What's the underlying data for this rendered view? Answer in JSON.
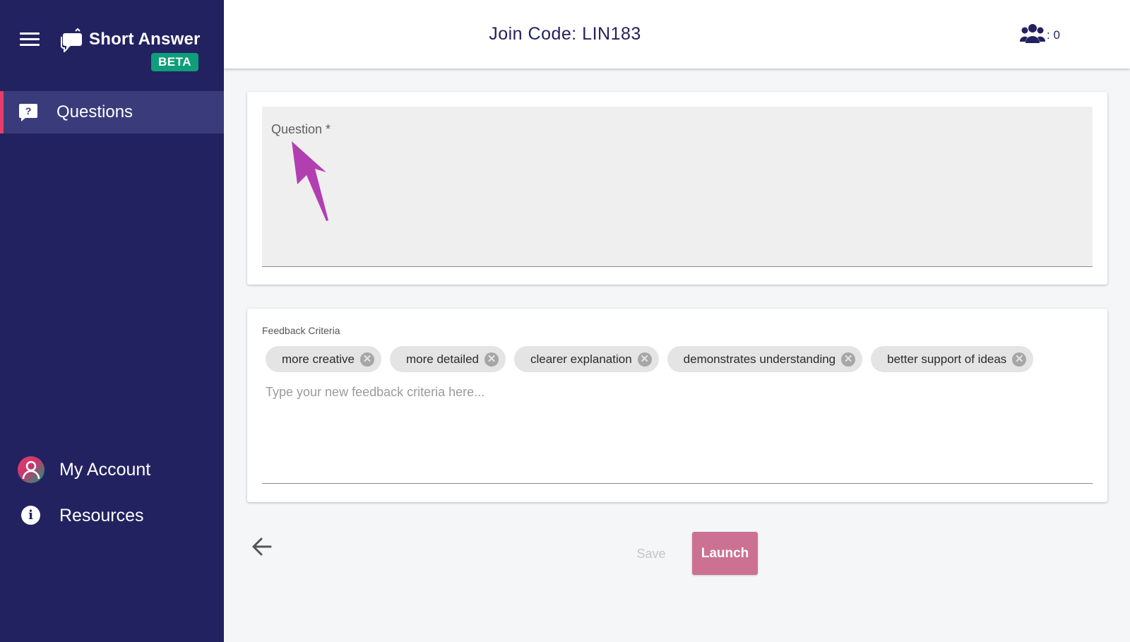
{
  "sidebar": {
    "app_title": "Short Answer",
    "beta_badge": "BETA",
    "nav": {
      "questions": "Questions",
      "my_account": "My Account",
      "resources": "Resources"
    }
  },
  "header": {
    "join_code": "Join Code: LIN183",
    "users_count": ": 0"
  },
  "question": {
    "label": "Question *",
    "value": ""
  },
  "feedback": {
    "label": "Feedback Criteria",
    "chips": [
      "more creative",
      "more detailed",
      "clearer explanation",
      "demonstrates understanding",
      "better support of ideas"
    ],
    "chip_remove_symbol": "✕",
    "input_placeholder": "Type your new feedback criteria here..."
  },
  "actions": {
    "save_label": "Save",
    "launch_label": "Launch"
  },
  "icons": {
    "menu": "hamburger-menu-icon",
    "logo": "speech-bubbles-icon",
    "questions": "question-bubble-icon",
    "users": "users-group-icon",
    "account": "account-avatar-icon",
    "resources": "info-icon",
    "back": "arrow-left-icon",
    "annotation": "pointer-arrow-annotation"
  },
  "colors": {
    "sidebar_bg": "#232260",
    "active_nav_bg": "#393b7b",
    "active_nav_accent": "#e83d6a",
    "beta_badge": "#0f9d7a",
    "launch_button": "#cc7192",
    "annotation_arrow": "#b23fb0"
  }
}
